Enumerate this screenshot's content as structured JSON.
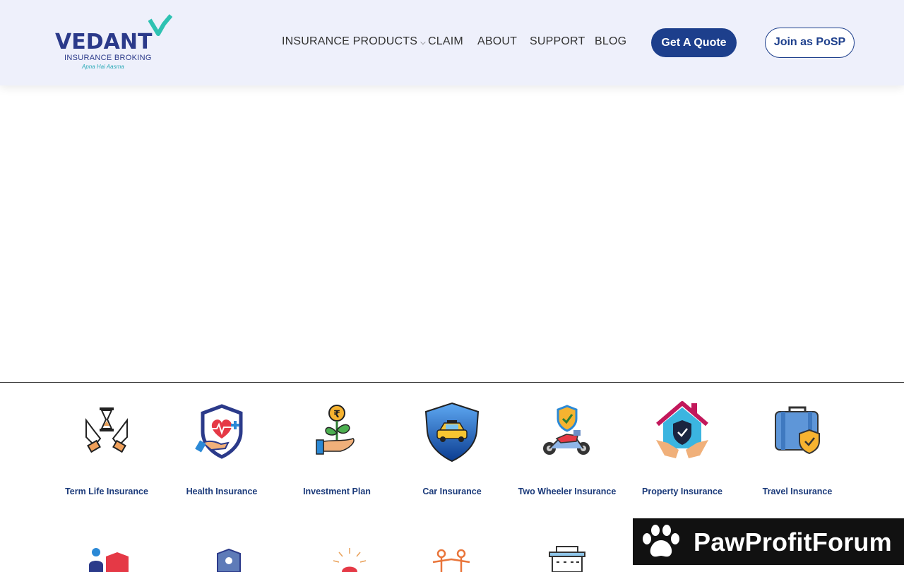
{
  "logo": {
    "name": "VEDANT",
    "subtitle": "INSURANCE BROKING",
    "tagline": "Apna Hai Aasma"
  },
  "nav": {
    "items": [
      {
        "label": "INSURANCE PRODUCTS",
        "has_dropdown": true
      },
      {
        "label": "CLAIM"
      },
      {
        "label": "ABOUT"
      },
      {
        "label": "SUPPORT"
      },
      {
        "label": "BLOG"
      }
    ],
    "quote_button": "Get A Quote",
    "posp_button": "Join as PoSP"
  },
  "products": [
    {
      "label": "Term Life Insurance",
      "icon": "term-life-icon"
    },
    {
      "label": "Health Insurance",
      "icon": "health-icon"
    },
    {
      "label": "Investment Plan",
      "icon": "investment-icon"
    },
    {
      "label": "Car Insurance",
      "icon": "car-icon"
    },
    {
      "label": "Two Wheeler Insurance",
      "icon": "two-wheeler-icon"
    },
    {
      "label": "Property Insurance",
      "icon": "property-icon"
    },
    {
      "label": "Travel Insurance",
      "icon": "travel-icon"
    }
  ],
  "promo": {
    "text": "PawProfitForum",
    "icon": "paw-icon"
  },
  "colors": {
    "brand": "#1d3f8c",
    "accent": "#2aa9b6",
    "header_bg": "#eef0fb"
  }
}
